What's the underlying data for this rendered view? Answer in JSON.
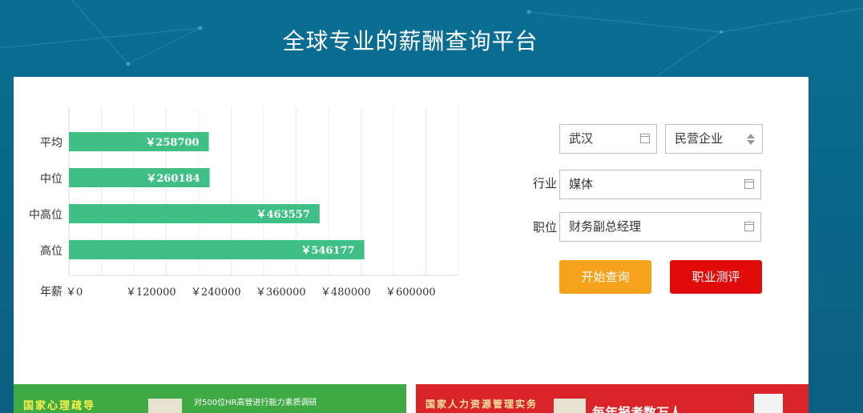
{
  "header": {
    "title": "全球专业的薪酬查询平台"
  },
  "form": {
    "city": "武汉",
    "company_type": "民营企业",
    "industry_label": "行业",
    "industry": "媒体",
    "position_label": "职位",
    "position": "财务副总经理",
    "query_button": "开始查询",
    "eval_button": "职业测评"
  },
  "chart_data": {
    "type": "bar",
    "orientation": "horizontal",
    "categories": [
      "平均",
      "中位",
      "中高位",
      "高位"
    ],
    "values": [
      258700,
      260184,
      463557,
      546177
    ],
    "value_labels": [
      "￥258700",
      "￥260184",
      "￥463557",
      "￥546177"
    ],
    "x_axis_title": "年薪",
    "x_ticks": [
      0,
      120000,
      240000,
      360000,
      480000,
      600000
    ],
    "x_tick_labels": [
      "￥0",
      "￥120000",
      "￥240000",
      "￥360000",
      "￥480000",
      "￥600000"
    ],
    "xlim": [
      0,
      720000
    ],
    "bar_color": "#3fbf86",
    "grid": true
  },
  "banners": {
    "left": {
      "text": "国家心理疏导",
      "sub": "对500位HR高管进行能力素质调研",
      "color": "#3eaa43"
    },
    "right": {
      "text": "国家人力资源管理实务",
      "sub": "每年报考数万人",
      "color": "#d9242a"
    }
  }
}
